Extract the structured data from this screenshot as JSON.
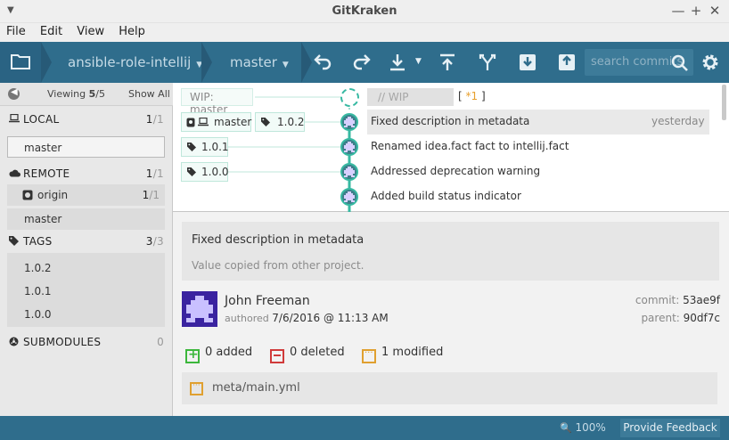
{
  "window": {
    "title": "GitKraken"
  },
  "menu": [
    "File",
    "Edit",
    "View",
    "Help"
  ],
  "toolbar": {
    "repo": "ansible-role-intellij",
    "branch": "master",
    "search_placeholder": "search commits"
  },
  "left_panel": {
    "viewing_label": "Viewing",
    "viewing_count": "5",
    "viewing_total": "/5",
    "show_all": "Show All",
    "local": {
      "label": "LOCAL",
      "count": "1",
      "total": "/1",
      "branches": [
        "master"
      ]
    },
    "remote": {
      "label": "REMOTE",
      "count": "1",
      "total": "/1",
      "remotes": [
        {
          "name": "origin",
          "count": "1",
          "total": "/1"
        }
      ],
      "branches": [
        "master"
      ]
    },
    "tags": {
      "label": "TAGS",
      "count": "3",
      "total": "/3",
      "items": [
        "1.0.2",
        "1.0.1",
        "1.0.0"
      ]
    },
    "submodules": {
      "label": "SUBMODULES",
      "count": "0"
    }
  },
  "graph": {
    "wip_label": "WIP: master",
    "wip_input_placeholder": "// WIP",
    "wip_changes_open": "[",
    "wip_changes_star": "*1",
    "wip_changes_close": "]",
    "rows": [
      {
        "branch": "master",
        "tag": "1.0.2",
        "message": "Fixed description in metadata",
        "date": "yesterday"
      },
      {
        "tag": "1.0.1",
        "message": "Renamed idea.fact fact to intellij.fact"
      },
      {
        "tag": "1.0.0",
        "message": "Addressed deprecation warning"
      },
      {
        "message": "Added build status indicator"
      }
    ]
  },
  "commit": {
    "title": "Fixed description in metadata",
    "body": "Value copied from other project.",
    "author": "John Freeman",
    "authored_label": "authored",
    "authored_date": "7/6/2016 @ 11:13 AM",
    "commit_label": "commit:",
    "commit_sha": "53ae9f",
    "parent_label": "parent:",
    "parent_sha": "90df7c",
    "added": "0 added",
    "deleted": "0 deleted",
    "modified": "1 modified",
    "files": [
      "meta/main.yml"
    ]
  },
  "status": {
    "zoom": "100%",
    "feedback": "Provide Feedback"
  },
  "colors": {
    "toolbar": "#2f6d8c",
    "graph_line": "#37b9a2",
    "added": "#3cb73c",
    "deleted": "#d03a3a",
    "modified": "#e0a030",
    "wip_star": "#e8a02e"
  }
}
